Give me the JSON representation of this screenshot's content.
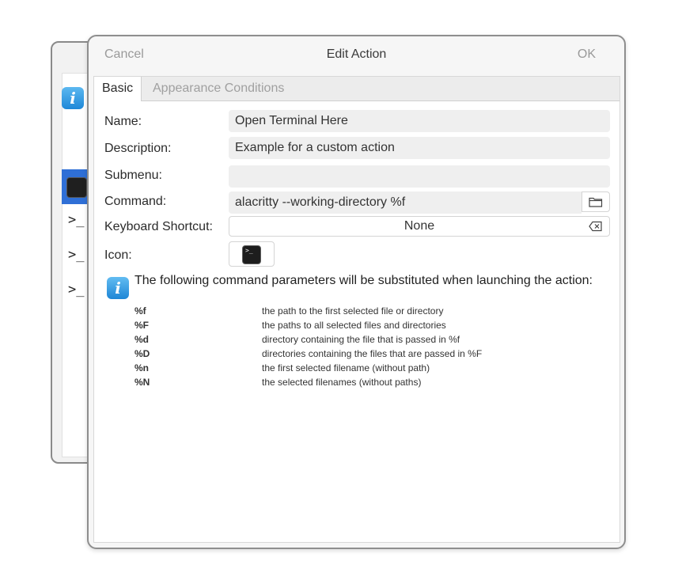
{
  "dialog": {
    "title": "Edit Action",
    "cancel_label": "Cancel",
    "ok_label": "OK"
  },
  "tabs": [
    {
      "label": "Basic",
      "active": true
    },
    {
      "label": "Appearance Conditions",
      "active": false
    }
  ],
  "form": {
    "name_label": "Name:",
    "name_value": "Open Terminal Here",
    "description_label": "Description:",
    "description_value": "Example for a custom action",
    "submenu_label": "Submenu:",
    "submenu_value": "",
    "command_label": "Command:",
    "command_value": "alacritty --working-directory %f",
    "shortcut_label": "Keyboard Shortcut:",
    "shortcut_value": "None",
    "icon_label": "Icon:"
  },
  "info": {
    "text": "The following command parameters will be substituted when launching the action:",
    "parameters": [
      {
        "key": "%f",
        "desc": "the path to the first selected file or directory"
      },
      {
        "key": "%F",
        "desc": "the paths to all selected files and directories"
      },
      {
        "key": "%d",
        "desc": "directory containing the file that is passed in %f"
      },
      {
        "key": "%D",
        "desc": "directories containing the files that are passed in %F"
      },
      {
        "key": "%n",
        "desc": "the first selected filename (without path)"
      },
      {
        "key": "%N",
        "desc": "the selected filenames (without paths)"
      }
    ]
  },
  "background_window": {
    "prompt_glyph": ">_"
  },
  "icons": {
    "info": "info-icon",
    "folder": "folder-icon",
    "clear": "backspace-clear-icon",
    "terminal": "terminal-icon"
  },
  "colors": {
    "selection": "#2f6fd6",
    "info_blue": "#1e86d6"
  }
}
